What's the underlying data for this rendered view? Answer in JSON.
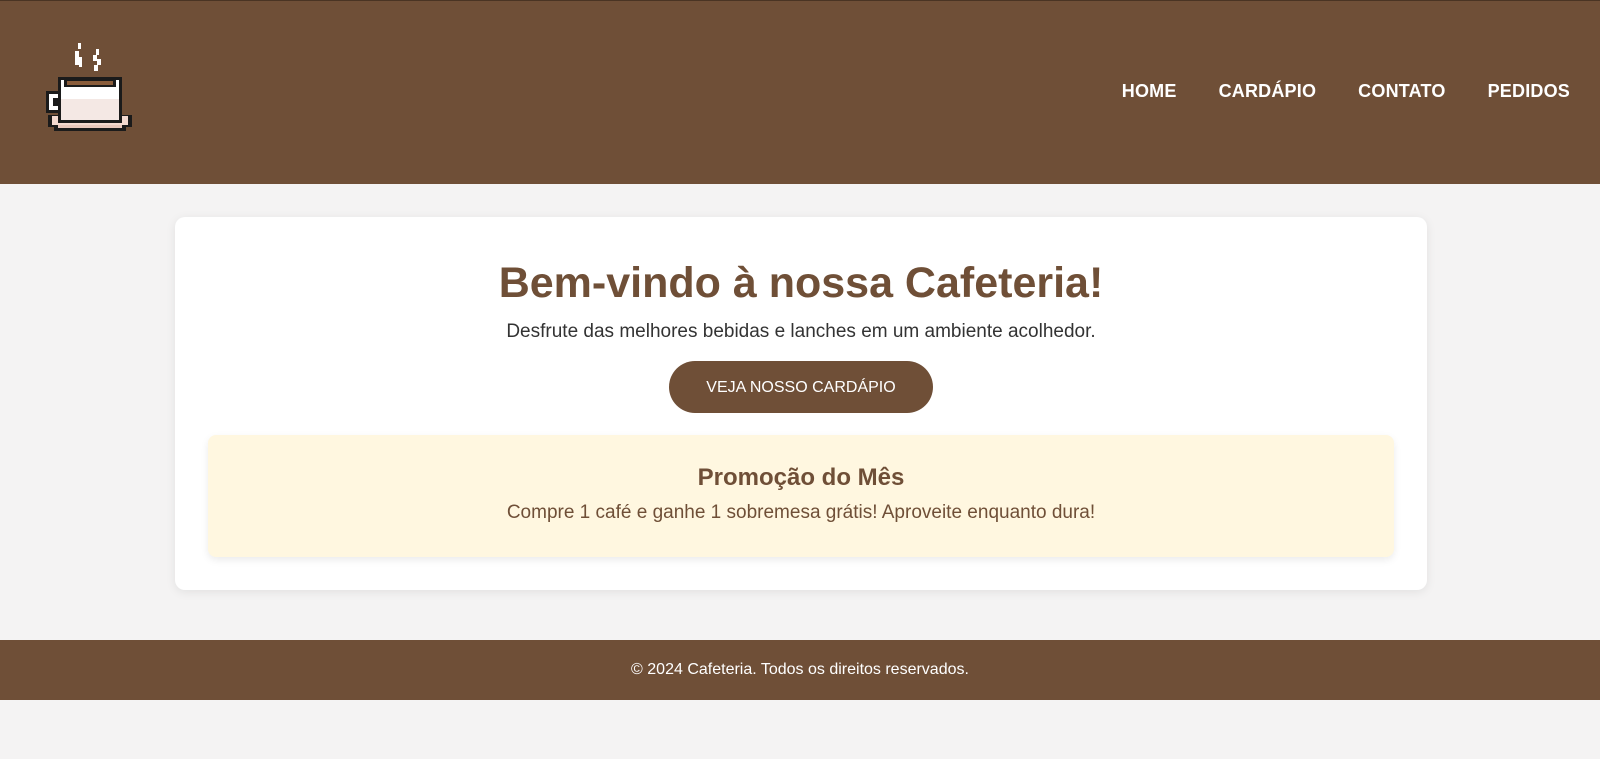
{
  "header": {
    "logo_icon": "coffee-cup-icon",
    "nav": [
      {
        "label": "HOME"
      },
      {
        "label": "CARDÁPIO"
      },
      {
        "label": "CONTATO"
      },
      {
        "label": "PEDIDOS"
      }
    ]
  },
  "hero": {
    "title": "Bem-vindo à nossa Cafeteria!",
    "subtitle": "Desfrute das melhores bebidas e lanches em um ambiente acolhedor.",
    "cta_label": "VEJA NOSSO CARDÁPIO"
  },
  "promo": {
    "title": "Promoção do Mês",
    "text": "Compre 1 café e ganhe 1 sobremesa grátis! Aproveite enquanto dura!"
  },
  "footer": {
    "text": "© 2024 Cafeteria. Todos os direitos reservados."
  },
  "colors": {
    "brand": "#6f4f37",
    "background": "#f4f3f3",
    "promo_background": "#fff7e0"
  }
}
